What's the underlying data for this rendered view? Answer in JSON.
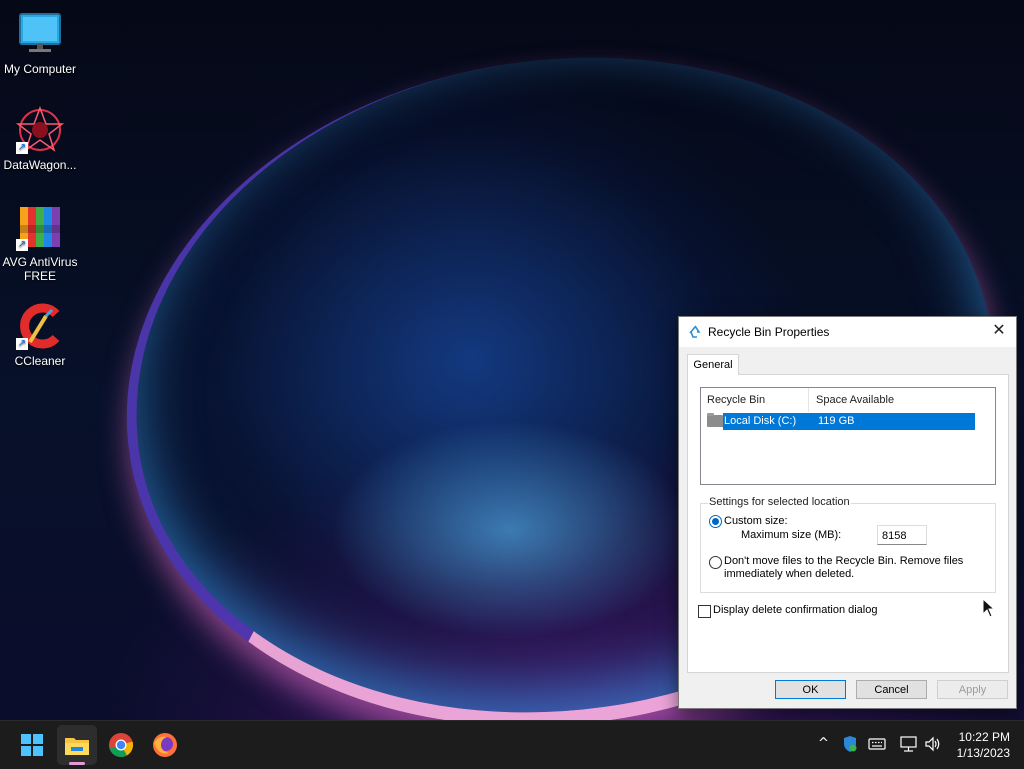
{
  "desktop": {
    "icons": [
      {
        "label": "My Computer",
        "icon": "monitor-icon",
        "shortcut": false
      },
      {
        "label": "DataWagon...",
        "icon": "datawagon-icon",
        "shortcut": true
      },
      {
        "label": "AVG AntiVirus FREE",
        "icon": "avg-icon",
        "shortcut": true
      },
      {
        "label": "CCleaner",
        "icon": "ccleaner-icon",
        "shortcut": true
      }
    ]
  },
  "dialog": {
    "title": "Recycle Bin Properties",
    "close_label": "✕",
    "tab": "General",
    "list": {
      "columns": [
        "Recycle Bin Location",
        "Space Available"
      ],
      "rows": [
        {
          "location": "Local Disk (C:)",
          "space": "119 GB"
        }
      ]
    },
    "settings": {
      "group_label": "Settings for selected location",
      "custom_size_label": "Custom size:",
      "max_size_label": "Maximum size (MB):",
      "max_size_value": "8158",
      "dont_move_label": "Don't move files to the Recycle Bin. Remove files immediately when deleted.",
      "selected_option": "custom_size"
    },
    "confirm_label": "Display delete confirmation dialog",
    "confirm_checked": false,
    "buttons": {
      "ok": "OK",
      "cancel": "Cancel",
      "apply": "Apply"
    },
    "accent": "#0078d7"
  },
  "taskbar": {
    "apps": [
      "windows-start-icon",
      "file-explorer-icon",
      "chrome-icon",
      "firefox-icon"
    ],
    "tray": {
      "chevron": "^"
    },
    "clock": {
      "time": "10:22 PM",
      "date": "1/13/2023"
    }
  }
}
